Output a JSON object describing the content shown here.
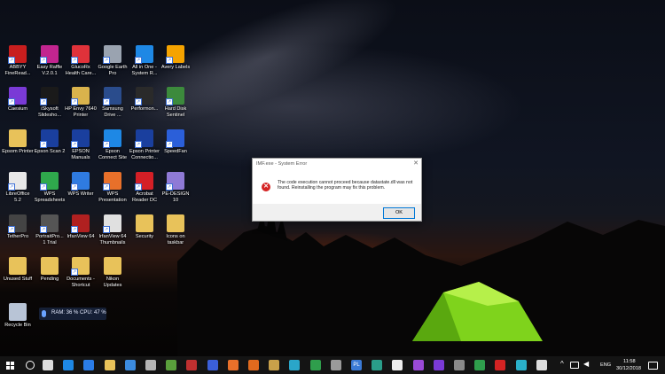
{
  "desktop": {
    "icons": [
      {
        "label": "ABBYY FineRead...",
        "color": "#c81e1e",
        "icon": "abbyy-icon",
        "shortcut": true
      },
      {
        "label": "Easy Raffle V.2.0.1",
        "color": "#c2258f",
        "icon": "easy-raffle-icon",
        "shortcut": true
      },
      {
        "label": "GlucoRx Health Care...",
        "color": "#e0323a",
        "icon": "glucorx-icon",
        "shortcut": true
      },
      {
        "label": "Google Earth Pro",
        "color": "#9aa3b0",
        "icon": "google-earth-icon",
        "shortcut": true
      },
      {
        "label": "All in One - System R...",
        "color": "#1e88e5",
        "icon": "chrome-icon",
        "shortcut": true
      },
      {
        "label": "Avery Labels",
        "color": "#f5a300",
        "icon": "avery-icon",
        "shortcut": true
      },
      {
        "label": "Caesium",
        "color": "#7a3ad6",
        "icon": "caesium-icon",
        "shortcut": true
      },
      {
        "label": "iSkysoft Slidesho...",
        "color": "#1a1a1a",
        "icon": "iskysoft-icon",
        "shortcut": true
      },
      {
        "label": "HP Envy 7640 Printer",
        "color": "#d9b34c",
        "icon": "hp-printer-icon",
        "shortcut": true
      },
      {
        "label": "Samsung Drive ...",
        "color": "#2a4c8c",
        "icon": "samsung-drive-icon",
        "shortcut": true
      },
      {
        "label": "Performon...",
        "color": "#2a2a2a",
        "icon": "performance-icon",
        "shortcut": true
      },
      {
        "label": "Hard Disk Sentinel",
        "color": "#3c8a3c",
        "icon": "hard-disk-sentinel-icon",
        "shortcut": true
      },
      {
        "label": "Epsom Printer",
        "color": "#e8c25a",
        "icon": "folder-icon",
        "shortcut": false
      },
      {
        "label": "Epson Scan 2",
        "color": "#1a3f9e",
        "icon": "epson-scan-icon",
        "shortcut": true
      },
      {
        "label": "EPSON Manuals",
        "color": "#1a3f9e",
        "icon": "epson-manuals-icon",
        "shortcut": true
      },
      {
        "label": "Epson Connect Site",
        "color": "#1e88e5",
        "icon": "chrome-icon",
        "shortcut": true
      },
      {
        "label": "Epson Printer Connectio...",
        "color": "#1a3f9e",
        "icon": "epson-connection-icon",
        "shortcut": true
      },
      {
        "label": "SpeedFan",
        "color": "#2b5fd9",
        "icon": "speedfan-icon",
        "shortcut": true
      },
      {
        "label": "LibreOffice 5.2",
        "color": "#e8e8e8",
        "icon": "libreoffice-icon",
        "shortcut": true
      },
      {
        "label": "WPS Spreadsheets",
        "color": "#2fa94c",
        "icon": "wps-spreadsheets-icon",
        "shortcut": true
      },
      {
        "label": "WPS Writer",
        "color": "#2f7be0",
        "icon": "wps-writer-icon",
        "shortcut": true
      },
      {
        "label": "WPS Presentation",
        "color": "#e8702a",
        "icon": "wps-presentation-icon",
        "shortcut": true
      },
      {
        "label": "Acrobat Reader DC",
        "color": "#d41f26",
        "icon": "acrobat-icon",
        "shortcut": true
      },
      {
        "label": "PE-DESIGN 10",
        "color": "#8f7ad6",
        "icon": "pe-design-icon",
        "shortcut": true
      },
      {
        "label": "TetherPro",
        "color": "#444444",
        "icon": "tetherpro-icon",
        "shortcut": true
      },
      {
        "label": "PortraitPro... 1 Trial",
        "color": "#555555",
        "icon": "portraitpro-icon",
        "shortcut": true
      },
      {
        "label": "IrfanView 64",
        "color": "#b02020",
        "icon": "irfanview-icon",
        "shortcut": true
      },
      {
        "label": "IrfanView 64 Thumbnails",
        "color": "#e0e0e0",
        "icon": "irfanview-thumbnails-icon",
        "shortcut": true
      },
      {
        "label": "Security",
        "color": "#e8c25a",
        "icon": "security-folder-icon",
        "shortcut": false
      },
      {
        "label": "Icons on taskbar",
        "color": "#e8c25a",
        "icon": "folder-icon",
        "shortcut": false
      },
      {
        "label": "Unused Stuff",
        "color": "#e8c25a",
        "icon": "folder-icon",
        "shortcut": false
      },
      {
        "label": "Pending",
        "color": "#e8c25a",
        "icon": "folder-icon",
        "shortcut": false
      },
      {
        "label": "Documents - Shortcut",
        "color": "#e8c25a",
        "icon": "documents-icon",
        "shortcut": true
      },
      {
        "label": "Nikon Updates",
        "color": "#e8c25a",
        "icon": "folder-icon",
        "shortcut": false
      },
      {
        "label": "Recycle Bin",
        "color": "#b8c4d6",
        "icon": "recycle-bin-icon",
        "shortcut": false
      }
    ],
    "widget_text": "RAM: 36 %  CPU: 47 %"
  },
  "dialog": {
    "title": "IMF.exe - System Error",
    "close_glyph": "✕",
    "error_glyph": "✕",
    "message": "The code execution cannot proceed because datastate.dll was not found. Reinstalling the program may fix this problem.",
    "ok_label": "OK"
  },
  "taskbar": {
    "apps": [
      {
        "icon": "task-view-icon",
        "color": "#dddddd"
      },
      {
        "icon": "chrome-icon",
        "color": "#1e88e5"
      },
      {
        "icon": "edge-icon",
        "color": "#2b7de9"
      },
      {
        "icon": "file-explorer-icon",
        "color": "#e8c25a"
      },
      {
        "icon": "photos-icon",
        "color": "#3c8ce0"
      },
      {
        "icon": "snipping-icon",
        "color": "#b5b5b5"
      },
      {
        "icon": "greenshot-icon",
        "color": "#5aa03c"
      },
      {
        "icon": "irfanview-icon",
        "color": "#c03030"
      },
      {
        "icon": "app-blue-icon",
        "color": "#3b5fd9"
      },
      {
        "icon": "wps-presentation-icon",
        "color": "#e8702a"
      },
      {
        "icon": "avast-icon",
        "color": "#e06a1e"
      },
      {
        "icon": "folder-icon",
        "color": "#c9a14a"
      },
      {
        "icon": "app-cyan-icon",
        "color": "#2aa6c9"
      },
      {
        "icon": "money-icon",
        "color": "#2f9e4c"
      },
      {
        "icon": "photo-viewer-icon",
        "color": "#9a9a9a"
      },
      {
        "icon": "pl-icon",
        "color": "#3a7ad6",
        "text": "PL"
      },
      {
        "icon": "app-teal-icon",
        "color": "#2a9e8a"
      },
      {
        "icon": "app-white-icon",
        "color": "#eeeeee"
      },
      {
        "icon": "app-purple-icon",
        "color": "#9a4ad6"
      },
      {
        "icon": "app-violet-icon",
        "color": "#7a3ad6"
      },
      {
        "icon": "app-gray-icon",
        "color": "#8a8a8a"
      },
      {
        "icon": "app-green-icon",
        "color": "#2f9e4c"
      },
      {
        "icon": "app-red-icon",
        "color": "#d42323"
      },
      {
        "icon": "app-cyan2-icon",
        "color": "#2ab0c9"
      },
      {
        "icon": "sysmon-icon",
        "color": "#dddddd"
      }
    ],
    "tray_lang": "ENG",
    "time": "11:58",
    "date": "30/12/2018"
  }
}
